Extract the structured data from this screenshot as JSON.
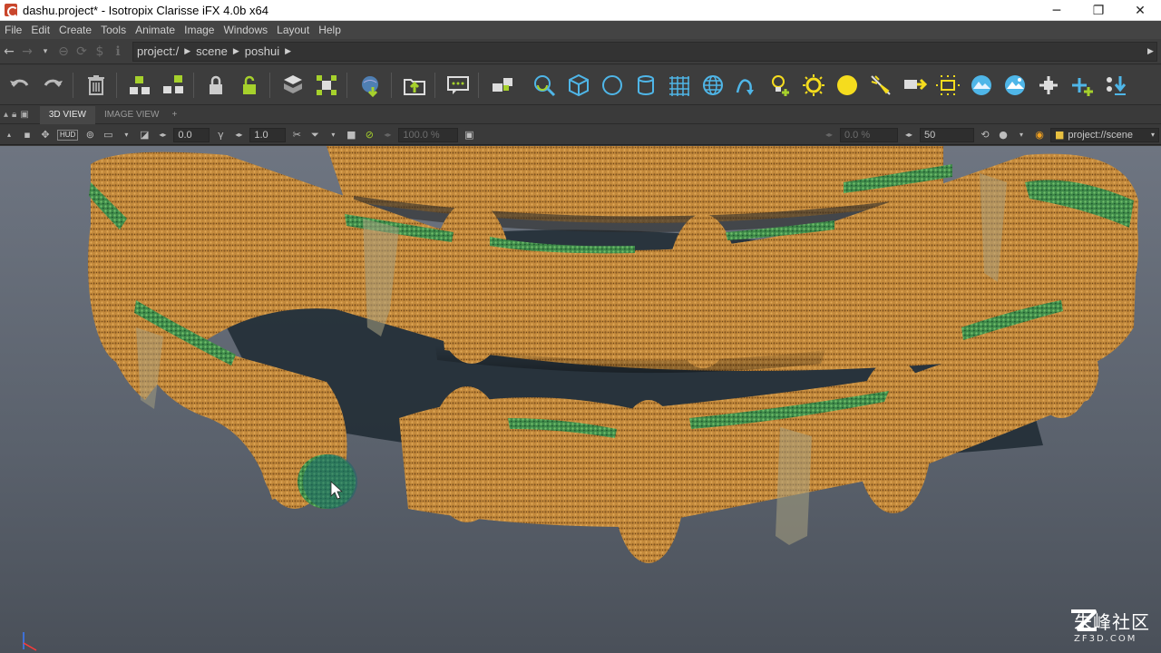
{
  "window": {
    "title": "dashu.project* - Isotropix Clarisse iFX 4.0b x64",
    "minimize": "─",
    "maximize": "❐",
    "close": "✕"
  },
  "menu": [
    "File",
    "Edit",
    "Create",
    "Tools",
    "Animate",
    "Image",
    "Windows",
    "Layout",
    "Help"
  ],
  "address": {
    "crumbs": [
      "project:/",
      "scene",
      "poshui"
    ]
  },
  "viewport_tabs": {
    "tab1": "3D VIEW",
    "tab2": "IMAGE VIEW",
    "add": "+"
  },
  "viewport_toolbar": {
    "hud": "HUD",
    "field1": "0.0",
    "field2": "1.0",
    "field3": "100.0 %",
    "field4": "0.0 %",
    "field5": "50",
    "context": "project://scene"
  },
  "watermark": {
    "cn": "朱峰社区",
    "en": "ZF3D.COM"
  },
  "colors": {
    "accent_green": "#a6d12c",
    "accent_blue": "#4fb6e8",
    "accent_yellow": "#f5dc1e",
    "viewport_bg": "#5f6671"
  }
}
